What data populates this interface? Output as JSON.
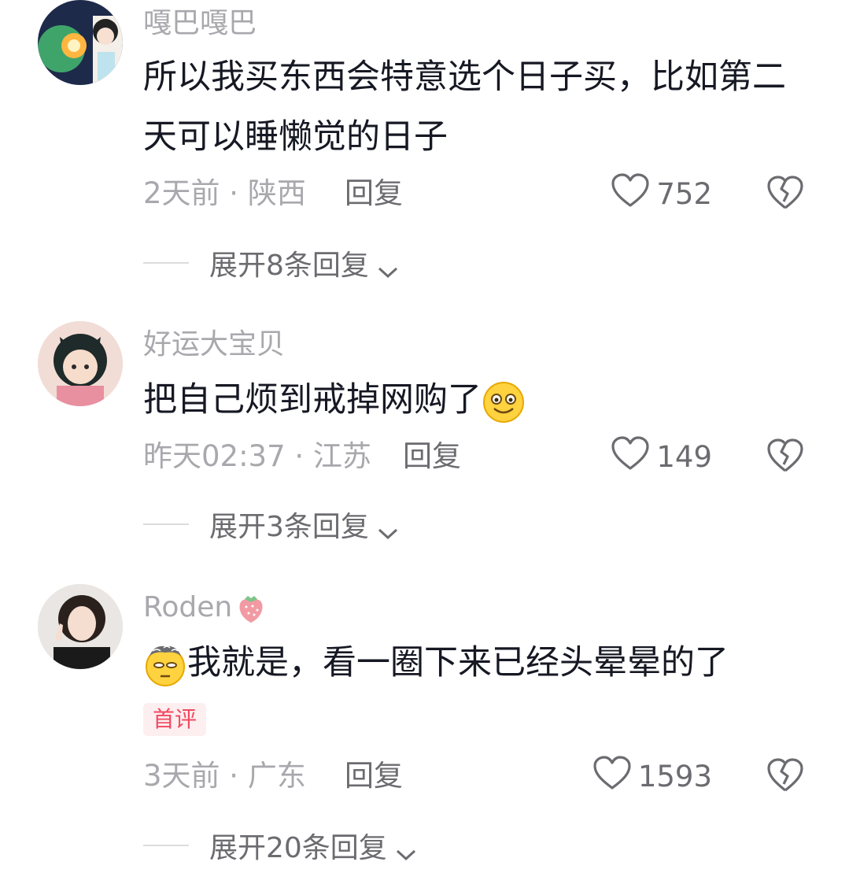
{
  "comments": [
    {
      "username": "嘎巴嘎巴",
      "content": "所以我买东西会特意选个日子买，比如第二天可以睡懒觉的日子",
      "time": "2天前",
      "location": "陕西",
      "reply_label": "回复",
      "likes": "752",
      "expand_label": "展开8条回复"
    },
    {
      "username": "好运大宝贝",
      "content": "把自己烦到戒掉网购了",
      "time": "昨天02:37",
      "location": "江苏",
      "reply_label": "回复",
      "likes": "149",
      "expand_label": "展开3条回复"
    },
    {
      "username": "Roden",
      "content": "我就是，看一圈下来已经头晕晕的了",
      "badge": "首评",
      "time": "3天前",
      "location": "广东",
      "reply_label": "回复",
      "likes": "1593",
      "expand_label": "展开20条回复"
    }
  ],
  "meta_separator": " · ",
  "colors": {
    "secondary_text": "#a8a8ad",
    "primary_text": "#161823",
    "badge_bg": "#fdeef0",
    "badge_text": "#f2485f"
  },
  "icons": [
    "heart-icon",
    "broken-heart-icon",
    "chevron-down-icon",
    "smile-emoji",
    "dizzy-emoji",
    "strawberry-icon"
  ]
}
